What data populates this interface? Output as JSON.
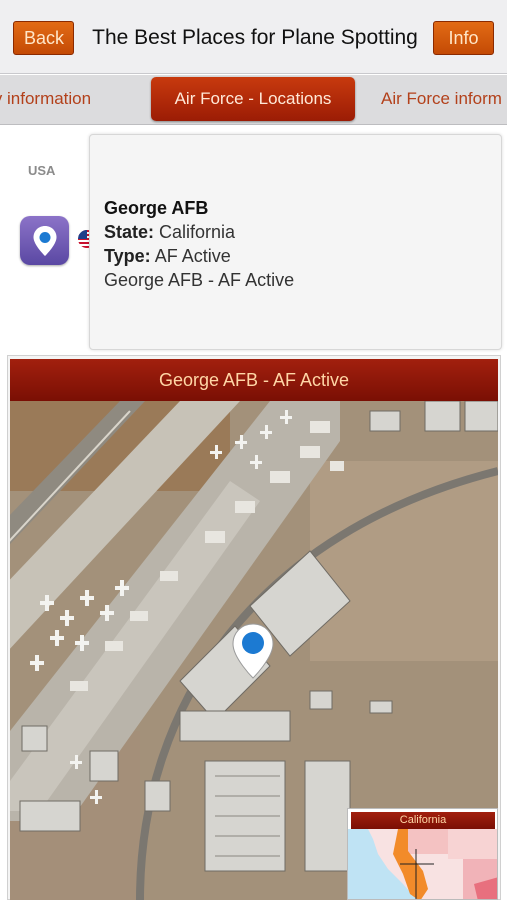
{
  "navbar": {
    "back_label": "Back",
    "title": "The Best Places for Plane Spotting",
    "info_label": "Info"
  },
  "tabs": [
    {
      "label": "ly information",
      "active": false
    },
    {
      "label": "Air Force - Locations",
      "active": true
    },
    {
      "label": "Air Force inform",
      "active": false
    }
  ],
  "location": {
    "country": "USA",
    "icon": "location-pin-icon",
    "flag": "us-flag-icon",
    "name": "George AFB",
    "state_label": "State:",
    "state_value": "California",
    "type_label": "Type:",
    "type_value": "AF Active",
    "summary": "George AFB - AF Active"
  },
  "map": {
    "title": "George AFB - AF Active",
    "marker": "map-pin-icon",
    "inset_title": "California"
  },
  "colors": {
    "accent_orange": "#d3570d",
    "banner_red": "#8e1708",
    "tab_text": "#b3411b",
    "pin_tile": "#6f5bb6",
    "map_marker": "#1c7ad2"
  }
}
